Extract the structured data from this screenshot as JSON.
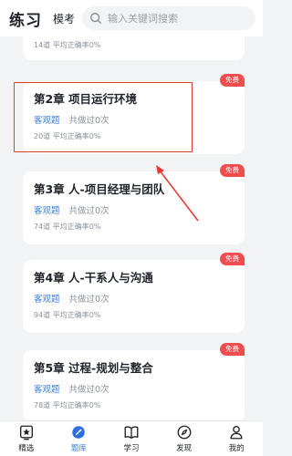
{
  "header": {
    "tab_practice": "练习",
    "tab_mock": "模考",
    "search_placeholder": "输入关键词搜索"
  },
  "cards": [
    {
      "title": "",
      "type": "",
      "done": "",
      "stats": "14道 平均正确率0%",
      "badge": ""
    },
    {
      "title": "第2章 项目运行环境",
      "type": "客观题",
      "done": "共做过0次",
      "stats": "20道 平均正确率0%",
      "badge": "免费"
    },
    {
      "title": "第3章 人-项目经理与团队",
      "type": "客观题",
      "done": "共做过0次",
      "stats": "74道 平均正确率0%",
      "badge": "免费"
    },
    {
      "title": "第4章 人-干系人与沟通",
      "type": "客观题",
      "done": "共做过0次",
      "stats": "94道 平均正确率0%",
      "badge": "免费"
    },
    {
      "title": "第5章 过程-规划与整合",
      "type": "客观题",
      "done": "共做过0次",
      "stats": "78道 平均正确率0%",
      "badge": "免费"
    }
  ],
  "nav": [
    {
      "label": "精选",
      "icon": "selected-icon"
    },
    {
      "label": "题库",
      "icon": "question-bank-icon"
    },
    {
      "label": "学习",
      "icon": "book-icon"
    },
    {
      "label": "发现",
      "icon": "compass-icon"
    },
    {
      "label": "我的",
      "icon": "profile-icon"
    }
  ],
  "colors": {
    "accent": "#3b7fe6",
    "badge": "#f04e4e",
    "annotation": "#e53935"
  }
}
